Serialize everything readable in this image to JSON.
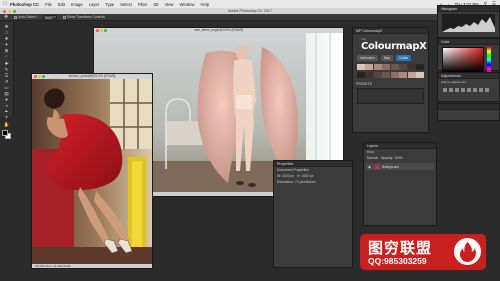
{
  "menubar": {
    "app_name": "Photoshop CC",
    "items": [
      "File",
      "Edit",
      "Image",
      "Layer",
      "Type",
      "Select",
      "Filter",
      "3D",
      "View",
      "Window",
      "Help"
    ],
    "clock": "Thu 3:07 PM"
  },
  "window": {
    "title": "Adobe Photoshop CC 2017"
  },
  "options_bar": {
    "auto_select": "Auto-Select:",
    "layer_value": "Layer",
    "show_transform": "Show Transform Controls"
  },
  "document_large": {
    "title": "rose_tinted_angel@100% (RGB/8)",
    "status": "100%   Doc: 9.9M/9.9M"
  },
  "document_small": {
    "title": "fashion_portrait@33.3% (RGB/8)",
    "status": "33.33%   Doc: 13.2M/13.2M"
  },
  "colourmap_panel": {
    "tab": "MP ColourmapX",
    "logo_top": "mp",
    "logo": "ColourmapX",
    "tabs": [
      "Instruction",
      "Map",
      "Colour"
    ],
    "active_tab": "Colour",
    "section_label": "PRESETS",
    "swatch_colors": [
      "#d9c6b8",
      "#c7a592",
      "#b08a78",
      "#8f6f62",
      "#6e564d",
      "#574441",
      "#3f3232",
      "#2a2222"
    ]
  },
  "histogram_panel": {
    "tab": "Histogram"
  },
  "color_panel": {
    "tab": "Color"
  },
  "adjustments_panel": {
    "tab": "Adjustments",
    "hint": "Add an adjustment"
  },
  "properties_panel": {
    "tab": "Properties",
    "section": "Document Properties",
    "width_label": "W:",
    "width_value": "1920 px",
    "height_label": "H:",
    "height_value": "1080 px",
    "resolution": "Resolution: 72 pixels/inch"
  },
  "layers_panel": {
    "tab": "Layers",
    "kind": "Kind",
    "mode": "Normal",
    "opacity": "Opacity: 100%",
    "layer_name": "Background"
  },
  "watermark": {
    "title": "图穷联盟",
    "qq": "QQ:985303259"
  },
  "colors": {
    "accent": "#2c6eb8",
    "watermark_red": "#c9201f",
    "photo_dress_red": "#b3131c"
  }
}
